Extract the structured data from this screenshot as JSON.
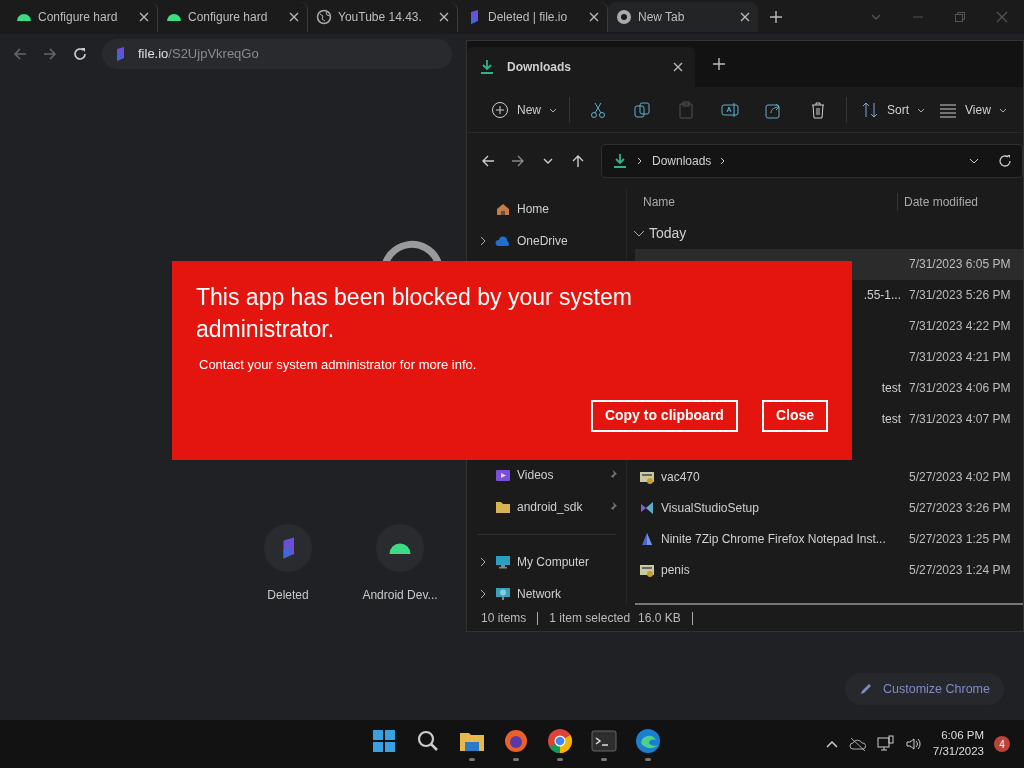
{
  "browser": {
    "tabs": [
      {
        "title": "Configure hard",
        "kind": "android",
        "selected": false
      },
      {
        "title": "Configure hard",
        "kind": "android",
        "selected": false
      },
      {
        "title": "YouTube 14.43.",
        "kind": "globe",
        "selected": false
      },
      {
        "title": "Deleted | file.io",
        "kind": "fileio",
        "selected": false
      },
      {
        "title": "New Tab",
        "kind": "chrome",
        "selected": true
      }
    ],
    "url": {
      "host": "file.io",
      "path": "/S2UjpVkreqGo"
    },
    "shortcuts": [
      {
        "label": "Deleted",
        "kind": "fileio"
      },
      {
        "label": "Android Dev...",
        "kind": "android"
      }
    ],
    "customize_button": "Customize Chrome"
  },
  "explorer": {
    "tab": {
      "title": "Downloads"
    },
    "toolbar": [
      {
        "kind": "new",
        "label": "New",
        "disabled": false
      },
      {
        "kind": "cut",
        "disabled": false
      },
      {
        "kind": "copy",
        "disabled": false
      },
      {
        "kind": "paste",
        "disabled": true
      },
      {
        "kind": "rename",
        "disabled": false
      },
      {
        "kind": "share",
        "disabled": false
      },
      {
        "kind": "delete",
        "disabled": false
      },
      {
        "kind": "sort",
        "label": "Sort",
        "disabled": false
      },
      {
        "kind": "view",
        "label": "View",
        "disabled": false
      }
    ],
    "breadcrumb": [
      "Downloads"
    ],
    "sidebar": [
      {
        "items": [
          {
            "label": "Home",
            "kind": "home",
            "expandable": false,
            "pinned": false
          },
          {
            "label": "OneDrive",
            "kind": "cloud",
            "expandable": true,
            "pinned": false
          }
        ]
      },
      {
        "items": [
          {
            "label": "Videos",
            "kind": "videos",
            "expandable": false,
            "pinned": true
          },
          {
            "label": "android_sdk",
            "kind": "folder",
            "expandable": false,
            "pinned": true
          }
        ]
      },
      {
        "items": [
          {
            "label": "My Computer",
            "kind": "computer",
            "expandable": true,
            "pinned": false
          },
          {
            "label": "Network",
            "kind": "network",
            "expandable": true,
            "pinned": false
          }
        ]
      }
    ],
    "columns": [
      "Name",
      "Date modified"
    ],
    "groups": [
      {
        "label": "Today",
        "expanded": true,
        "rows": [
          {
            "date": "7/31/2023 6:05 PM",
            "selected": true
          },
          {
            "name": ".55-1...",
            "date": "7/31/2023 5:26 PM",
            "selected": false
          },
          {
            "date": "7/31/2023 4:22 PM",
            "selected": false
          },
          {
            "date": "7/31/2023 4:21 PM",
            "selected": false
          },
          {
            "name": "test",
            "date": "7/31/2023 4:06 PM",
            "selected": false
          },
          {
            "name": "test",
            "date": "7/31/2023 4:07 PM",
            "selected": false
          }
        ]
      },
      {
        "rows": [
          {
            "name": "vac470",
            "kind": "setup",
            "date": "5/27/2023 4:02 PM",
            "selected": false
          },
          {
            "name": "VisualStudioSetup",
            "kind": "vs",
            "date": "5/27/2023 3:26 PM",
            "selected": false
          },
          {
            "name": "Ninite 7Zip Chrome Firefox Notepad Inst...",
            "kind": "ninite",
            "date": "5/27/2023 1:25 PM",
            "selected": false
          },
          {
            "name": "penis",
            "kind": "setup",
            "date": "5/27/2023 1:24 PM",
            "selected": false
          }
        ]
      }
    ],
    "status": {
      "count": "10 items",
      "selection": "1 item selected",
      "size": "16.0 KB"
    }
  },
  "dialog": {
    "title": "This app has been blocked by your system administrator.",
    "message": "Contact your system administrator for more info.",
    "buttons": [
      "Copy to clipboard",
      "Close"
    ]
  },
  "taskbar": {
    "apps": [
      {
        "kind": "start",
        "running": false
      },
      {
        "kind": "search",
        "running": false
      },
      {
        "kind": "explorer",
        "running": true
      },
      {
        "kind": "firefox",
        "running": true
      },
      {
        "kind": "chrome",
        "running": true
      },
      {
        "kind": "terminal",
        "running": true
      },
      {
        "kind": "edge",
        "running": true
      }
    ],
    "time": "6:06 PM",
    "date": "7/31/2023",
    "notifications": "4"
  }
}
